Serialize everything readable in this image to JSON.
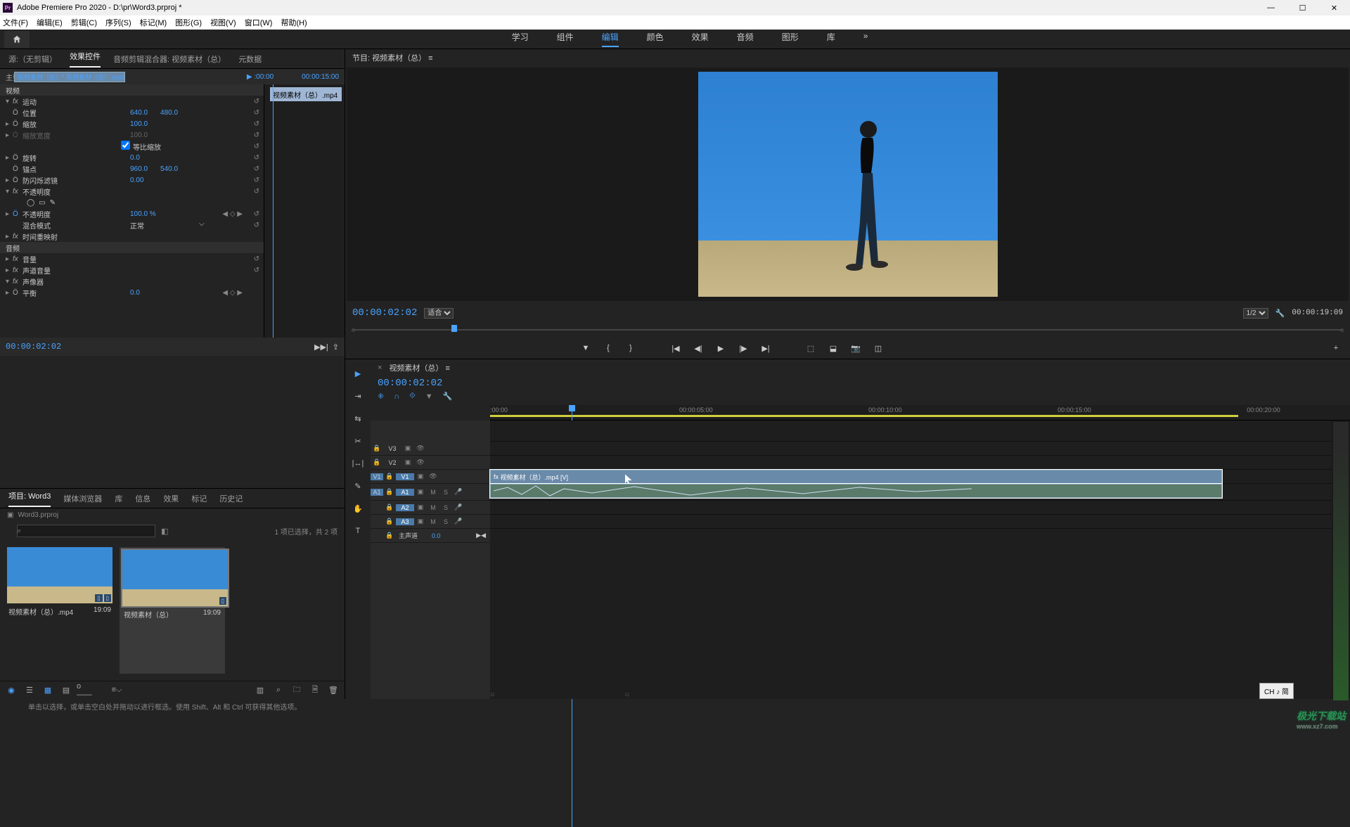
{
  "app": {
    "title": "Adobe Premiere Pro 2020 - D:\\pr\\Word3.prproj *",
    "logo_text": "Pr"
  },
  "menu": [
    "文件(F)",
    "编辑(E)",
    "剪辑(C)",
    "序列(S)",
    "标记(M)",
    "图形(G)",
    "视图(V)",
    "窗口(W)",
    "帮助(H)"
  ],
  "workspaces": [
    "学习",
    "组件",
    "编辑",
    "颜色",
    "效果",
    "音频",
    "图形",
    "库"
  ],
  "workspace_active": "编辑",
  "source_tabs": [
    "源:（无剪辑）",
    "效果控件",
    "音频剪辑混合器: 视频素材（总）",
    "元数据"
  ],
  "source_tab_active": "效果控件",
  "ec": {
    "master_src": "主要 * 视频素材（总）.mp4",
    "clip_ref": "视频素材（总）* 视频素材（总）.mp4",
    "time_start": "▶ :00:00",
    "time_end": "00:00:15:00",
    "track_clip": "视频素材（总）.mp4",
    "section_video": "视频",
    "motion": "运动",
    "position_label": "位置",
    "position_x": "640.0",
    "position_y": "480.0",
    "scale_label": "缩放",
    "scale_val": "100.0",
    "scale_w_label": "缩放宽度",
    "scale_w_val": "100.0",
    "uniform_label": "等比缩放",
    "rotation_label": "旋转",
    "rotation_val": "0.0",
    "anchor_label": "锚点",
    "anchor_x": "960.0",
    "anchor_y": "540.0",
    "flicker_label": "防闪烁滤镜",
    "flicker_val": "0.00",
    "opacity_label": "不透明度",
    "opacity_val_label": "不透明度",
    "opacity_val": "100.0 %",
    "blend_label": "混合模式",
    "blend_val": "正常",
    "remap_label": "时间重映射",
    "section_audio": "音频",
    "volume_label": "音量",
    "channel_label": "声道音量",
    "panner_label": "声像器",
    "balance_label": "平衡",
    "balance_val": "0.0",
    "footer_tc": "00:00:02:02"
  },
  "project_tabs": [
    "项目: Word3",
    "媒体浏览器",
    "库",
    "信息",
    "效果",
    "标记",
    "历史记"
  ],
  "project_tab_active": "项目: Word3",
  "project": {
    "filename": "Word3.prproj",
    "search_placeholder": "",
    "count_text": "1 项已选择，共 2 项",
    "items": [
      {
        "name": "视频素材（总）.mp4",
        "dur": "19:09"
      },
      {
        "name": "视频素材（总）",
        "dur": "19:09"
      }
    ]
  },
  "program": {
    "title": "节目: 视频素材（总） ≡",
    "tc": "00:00:02:02",
    "fit": "适合",
    "scale": "1/2",
    "duration": "00:00:19:09"
  },
  "timeline": {
    "seq_name": "视频素材（总） ≡",
    "tc": "00:00:02:02",
    "ticks": [
      ":00:00",
      "00:00:05:00",
      "00:00:10:00",
      "00:00:15:00",
      "00:00:20:00"
    ],
    "tracks_v": [
      "V3",
      "V2",
      "V1"
    ],
    "tracks_a": [
      "A1",
      "A2",
      "A3"
    ],
    "master": "主声道",
    "master_val": "0.0",
    "clip_v_label": "视频素材（总）.mp4 [V]"
  },
  "status": "单击以选择，或单击空白处并拖动以进行框选。使用 Shift、Alt 和 Ctrl 可获得其他选项。",
  "ime": "CH ♪ 简",
  "watermark": "极光下载站",
  "watermark_url": "www.xz7.com"
}
